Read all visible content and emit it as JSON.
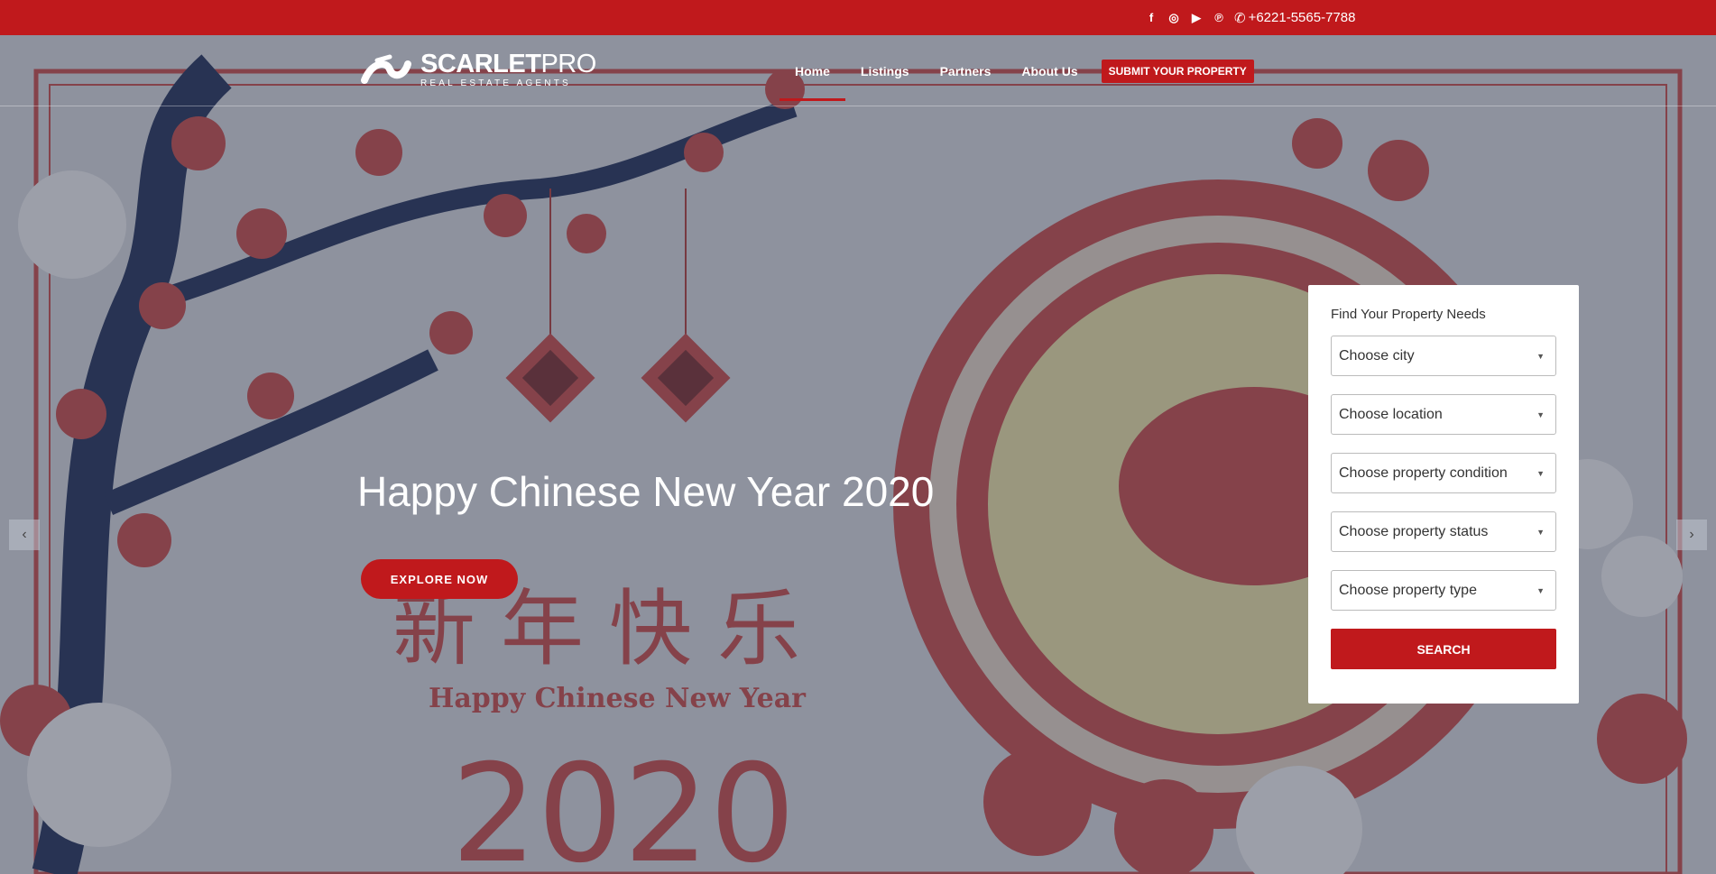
{
  "topbar": {
    "socials": [
      {
        "icon": "facebook-icon",
        "glyph": "f"
      },
      {
        "icon": "instagram-icon",
        "glyph": "◎"
      },
      {
        "icon": "youtube-icon",
        "glyph": "▶"
      },
      {
        "icon": "pinterest-icon",
        "glyph": "℗"
      }
    ],
    "phone_icon": "phone-icon",
    "phone": "+6221-5565-7788"
  },
  "header": {
    "logo_name_bold": "SCARLET",
    "logo_name_light": "PRO",
    "logo_sub": "REAL ESTATE AGENTS",
    "nav": [
      {
        "label": "Home",
        "active": true
      },
      {
        "label": "Listings",
        "active": false
      },
      {
        "label": "Partners",
        "active": false
      },
      {
        "label": "About Us",
        "active": false
      }
    ],
    "submit_label": "SUBMIT YOUR PROPERTY"
  },
  "hero": {
    "title": "Happy Chinese New Year 2020",
    "cta": "EXPLORE NOW",
    "bg_chinese": "新年快乐",
    "bg_caption": "Happy Chinese New Year",
    "bg_year": "2020",
    "prev_icon": "chevron-left-icon",
    "next_icon": "chevron-right-icon"
  },
  "search": {
    "title": "Find Your Property Needs",
    "selects": [
      {
        "placeholder": "Choose city"
      },
      {
        "placeholder": "Choose location"
      },
      {
        "placeholder": "Choose property condition"
      },
      {
        "placeholder": "Choose property status"
      },
      {
        "placeholder": "Choose property type"
      }
    ],
    "button": "SEARCH"
  },
  "colors": {
    "accent": "#c0191c"
  }
}
